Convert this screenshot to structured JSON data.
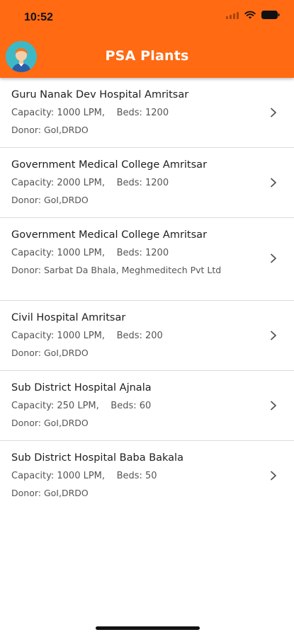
{
  "status": {
    "time": "10:52"
  },
  "header": {
    "title": "PSA Plants"
  },
  "plants": [
    {
      "name": "Guru Nanak Dev Hospital Amritsar",
      "capacity": "Capacity: 1000 LPM,",
      "beds": "Beds: 1200",
      "donor": "Donor: GoI,DRDO"
    },
    {
      "name": "Government Medical College Amritsar",
      "capacity": "Capacity: 2000 LPM,",
      "beds": "Beds: 1200",
      "donor": "Donor: GoI,DRDO"
    },
    {
      "name": "Government Medical College Amritsar",
      "capacity": "Capacity: 1000 LPM,",
      "beds": "Beds: 1200",
      "donor": "Donor: Sarbat Da Bhala, Meghmeditech Pvt Ltd"
    },
    {
      "name": "Civil Hospital Amritsar",
      "capacity": "Capacity: 1000 LPM,",
      "beds": "Beds: 200",
      "donor": "Donor: GoI,DRDO"
    },
    {
      "name": "Sub District Hospital Ajnala",
      "capacity": "Capacity: 250 LPM,",
      "beds": "Beds: 60",
      "donor": "Donor: GoI,DRDO"
    },
    {
      "name": "Sub District Hospital Baba Bakala",
      "capacity": "Capacity: 1000 LPM,",
      "beds": "Beds: 50",
      "donor": "Donor: GoI,DRDO"
    }
  ],
  "colors": {
    "header": "#ff6a13",
    "avatar_bg": "#3fb8c6",
    "title": "#ffffff",
    "divider": "#dcdcdc"
  },
  "icons": {
    "avatar": "user-avatar-icon",
    "chevron": "chevron-right-icon",
    "wifi": "wifi-icon",
    "battery": "battery-icon",
    "signal": "signal-icon"
  }
}
